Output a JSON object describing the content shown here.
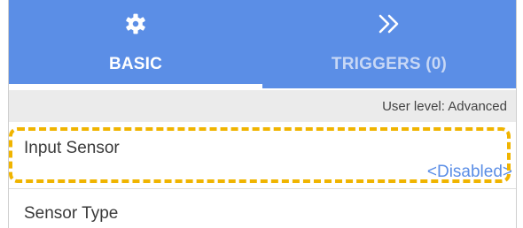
{
  "tabs": [
    {
      "label": "BASIC",
      "icon": "gear-icon",
      "active": true
    },
    {
      "label": "TRIGGERS (0)",
      "icon": "double-chevron-right-icon",
      "active": false
    }
  ],
  "user_level": "User level: Advanced",
  "rows": [
    {
      "label": "Input Sensor",
      "value": "<Disabled>"
    },
    {
      "label": "Sensor Type"
    }
  ],
  "colors": {
    "tab_bar": "#5b8ee6",
    "value_text": "#5b8ee6",
    "highlight": "#f0b400",
    "level_bar": "#ebebeb"
  }
}
